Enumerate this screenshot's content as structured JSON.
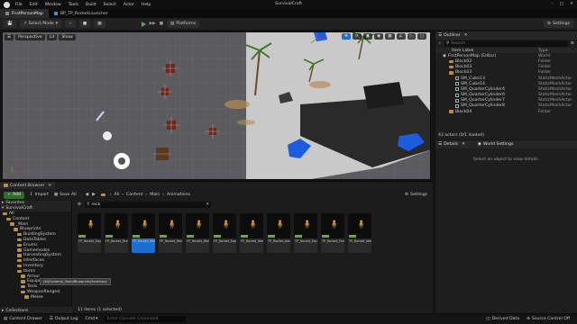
{
  "window": {
    "menu": [
      "File",
      "Edit",
      "Window",
      "Tools",
      "Build",
      "Select",
      "Actor",
      "Help"
    ],
    "title": "SurvivalCraft"
  },
  "tabs": [
    {
      "label": "FirstPersonMap"
    },
    {
      "label": "BP_TP_RocketLauncher"
    }
  ],
  "toolbar": {
    "select_mode": "Select Mode",
    "platforms": "Platforms",
    "settings": "Settings"
  },
  "viewport": {
    "perspective": "Perspective",
    "lit": "Lit",
    "show": "Show"
  },
  "outliner": {
    "title": "Outliner",
    "search_placeholder": "Search...",
    "col_label": "Item Label",
    "col_type": "Type",
    "rows": [
      {
        "label": "FirstPersonMap (Editor)",
        "type": "World",
        "kind": "world",
        "indent": 0,
        "selected": false
      },
      {
        "label": "Block02",
        "type": "Folder",
        "kind": "folder",
        "indent": 1,
        "selected": false
      },
      {
        "label": "Block03",
        "type": "Folder",
        "kind": "folder",
        "indent": 1,
        "selected": false
      },
      {
        "label": "Block03",
        "type": "Folder",
        "kind": "folder",
        "indent": 1,
        "selected": false
      },
      {
        "label": "SM_Cube13",
        "type": "StaticMeshActor",
        "kind": "mesh",
        "indent": 2,
        "selected": false
      },
      {
        "label": "SM_Cube14",
        "type": "StaticMeshActor",
        "kind": "mesh",
        "indent": 2,
        "selected": false
      },
      {
        "label": "SM_QuarterCylinder4",
        "type": "StaticMeshActor",
        "kind": "mesh",
        "indent": 2,
        "selected": false
      },
      {
        "label": "SM_QuarterCylinder6",
        "type": "StaticMeshActor",
        "kind": "mesh",
        "indent": 2,
        "selected": false
      },
      {
        "label": "SM_QuarterCylinder7",
        "type": "StaticMeshActor",
        "kind": "mesh",
        "indent": 2,
        "selected": false
      },
      {
        "label": "SM_QuarterCylinder8",
        "type": "StaticMeshActor",
        "kind": "mesh",
        "indent": 2,
        "selected": false
      },
      {
        "label": "Block04",
        "type": "Folder",
        "kind": "folder",
        "indent": 1,
        "selected": false
      }
    ],
    "footer": "43 actors (0/1 loaded)"
  },
  "details": {
    "tab1": "Details",
    "tab2": "World Settings",
    "empty": "Select an object to view details."
  },
  "content_browser": {
    "tab": "Content Browser",
    "add": "Add",
    "import": "Import",
    "save_all": "Save All",
    "settings": "Settings",
    "path": [
      "All",
      "Content",
      "Main",
      "Animations"
    ],
    "search_value": "rock",
    "favorites": "Favorites",
    "project": "SurvivalCraft",
    "tree": [
      {
        "label": "All",
        "indent": 0
      },
      {
        "label": "Content",
        "indent": 1
      },
      {
        "label": "_Main",
        "indent": 2
      },
      {
        "label": "Blueprints",
        "indent": 3
      },
      {
        "label": "BuildingSystem",
        "indent": 4
      },
      {
        "label": "DataTables",
        "indent": 4
      },
      {
        "label": "Enums",
        "indent": 4
      },
      {
        "label": "Gamemodes",
        "indent": 4
      },
      {
        "label": "HarvestingSystem",
        "indent": 4
      },
      {
        "label": "Interfaces",
        "indent": 4
      },
      {
        "label": "Inventory",
        "indent": 4
      },
      {
        "label": "Items",
        "indent": 4
      },
      {
        "label": "Armor",
        "indent": 5
      },
      {
        "label": "Equipment",
        "indent": 5
      },
      {
        "label": "Tools",
        "indent": 5
      },
      {
        "label": "WeaponRanged",
        "indent": 5
      },
      {
        "label": "Melee",
        "indent": 6
      }
    ],
    "tooltip": "/All/Content/_Main/Blueprints/Inventory",
    "collections": "Collections",
    "assets": [
      {
        "name": "FP_Rocket_Equip",
        "selected": false
      },
      {
        "name": "FP_Rocket_Fire",
        "selected": false
      },
      {
        "name": "FP_Rocket_Idle_Animation",
        "selected": true
      },
      {
        "name": "FP_Rocket_Reload",
        "selected": false
      },
      {
        "name": "FP_Rocket_Walk",
        "selected": false
      },
      {
        "name": "FP_Rocket_Equip",
        "selected": false
      },
      {
        "name": "FP_Rocket_Idle",
        "selected": false
      },
      {
        "name": "TP_Rocket_Aim",
        "selected": false
      },
      {
        "name": "TP_Rocket_Equip",
        "selected": false
      },
      {
        "name": "TP_Rocket_Fire",
        "selected": false
      },
      {
        "name": "TP_Rocket_Idle",
        "selected": false
      }
    ],
    "item_count": "11 items (1 selected)"
  },
  "statusbar": {
    "content_drawer": "Content Drawer",
    "output_log": "Output Log",
    "cmd": "Cmd",
    "cmd_placeholder": "Enter Console Command",
    "derived_data": "Derived Data",
    "source_control": "Source Control Off"
  }
}
